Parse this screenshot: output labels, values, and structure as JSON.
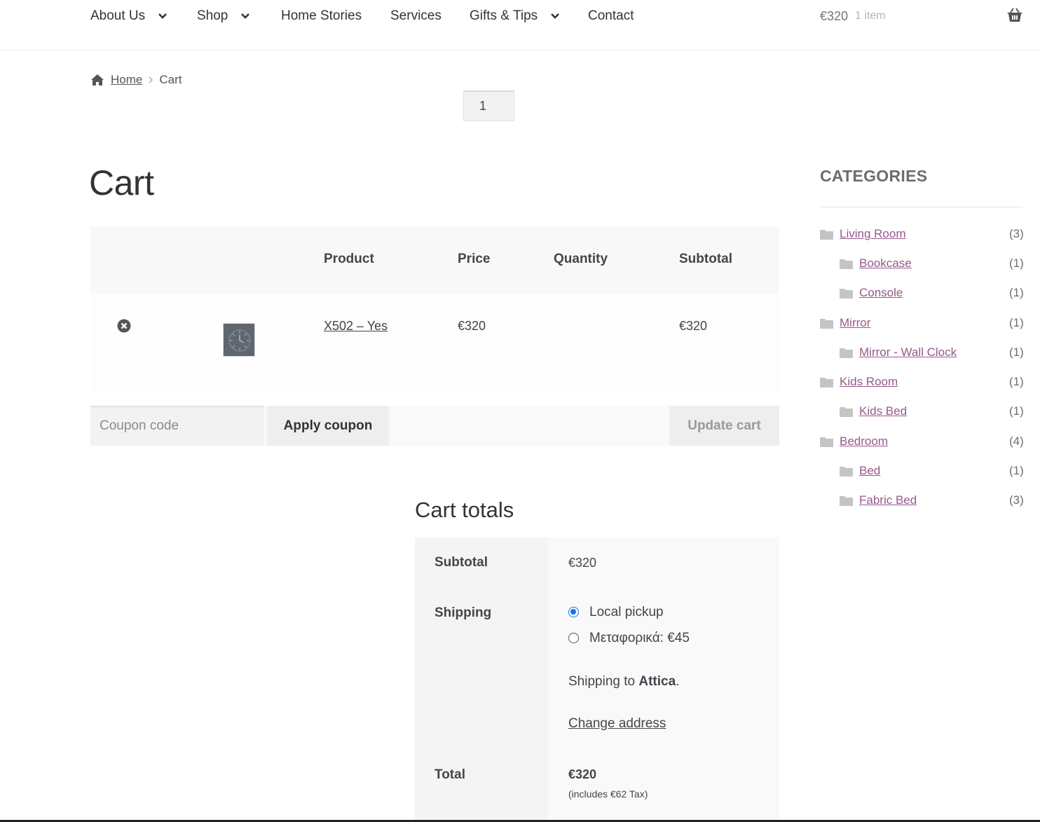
{
  "nav": {
    "items": [
      {
        "label": "About Us",
        "has_dropdown": true
      },
      {
        "label": "Shop",
        "has_dropdown": true
      },
      {
        "label": "Home Stories",
        "has_dropdown": false
      },
      {
        "label": "Services",
        "has_dropdown": false
      },
      {
        "label": "Gifts & Tips",
        "has_dropdown": true
      },
      {
        "label": "Contact",
        "has_dropdown": false
      }
    ],
    "mini_cart": {
      "amount": "€320",
      "count": "1 item",
      "icon": "basket-icon"
    }
  },
  "breadcrumb": {
    "home": "Home",
    "current": "Cart"
  },
  "page": {
    "title": "Cart"
  },
  "cart": {
    "headers": {
      "product": "Product",
      "price": "Price",
      "quantity": "Quantity",
      "subtotal": "Subtotal"
    },
    "items": [
      {
        "name": "X502 – Yes",
        "price": "€320",
        "quantity": "1",
        "subtotal": "€320"
      }
    ],
    "coupon_placeholder": "Coupon code",
    "apply_coupon": "Apply coupon",
    "update_cart": "Update cart"
  },
  "totals": {
    "title": "Cart totals",
    "subtotal_label": "Subtotal",
    "subtotal_value": "€320",
    "shipping_label": "Shipping",
    "shipping_options": [
      {
        "label": "Local pickup",
        "checked": true
      },
      {
        "label": "Μεταφορικά: €45",
        "checked": false
      }
    ],
    "shipping_to_prefix": "Shipping to",
    "shipping_to_region": "Attica",
    "shipping_to_suffix": ".",
    "change_address": "Change address",
    "total_label": "Total",
    "total_value": "€320",
    "tax_note": "(includes €62 Tax)"
  },
  "sidebar": {
    "title": "CATEGORIES",
    "categories": [
      {
        "label": "Living Room",
        "count": "(3)",
        "level": 0
      },
      {
        "label": "Bookcase",
        "count": "(1)",
        "level": 1
      },
      {
        "label": "Console",
        "count": "(1)",
        "level": 1
      },
      {
        "label": "Mirror",
        "count": "(1)",
        "level": 0
      },
      {
        "label": "Mirror - Wall Clock",
        "count": "(1)",
        "level": 1
      },
      {
        "label": "Kids Room",
        "count": "(1)",
        "level": 0
      },
      {
        "label": "Kids Bed",
        "count": "(1)",
        "level": 1
      },
      {
        "label": "Bedroom",
        "count": "(4)",
        "level": 0
      },
      {
        "label": "Bed",
        "count": "(1)",
        "level": 1
      },
      {
        "label": "Fabric Bed",
        "count": "(3)",
        "level": 1
      }
    ]
  },
  "colors": {
    "link": "#96588a",
    "radio_checked": "#1a73e8",
    "text": "#43454b"
  }
}
